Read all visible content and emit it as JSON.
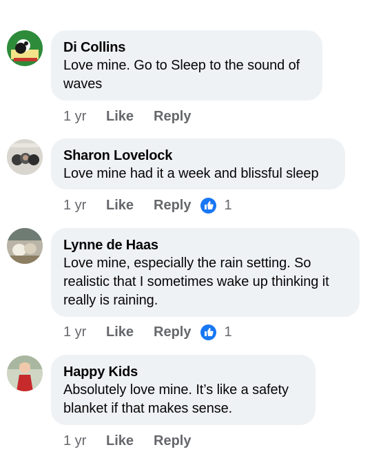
{
  "colors": {
    "bubble": "#eff2f5",
    "meta": "#65676b",
    "like_badge": "#1877f2"
  },
  "comments": [
    {
      "author": "Di Collins",
      "text": "Love mine. Go to Sleep to the sound of waves",
      "time": "1 yr",
      "like_label": "Like",
      "reply_label": "Reply",
      "avatar_icon": "dog-avatar-icon"
    },
    {
      "author": "Sharon Lovelock",
      "text": "Love mine had it a week and blissful sleep",
      "time": "1 yr",
      "like_label": "Like",
      "reply_label": "Reply",
      "reactions": "1",
      "avatar_icon": "family-photo-avatar-icon"
    },
    {
      "author": "Lynne de Haas",
      "text": "Love mine, especially the rain setting. So realistic that I sometimes wake up thinking it really is raining.",
      "time": "1 yr",
      "like_label": "Like",
      "reply_label": "Reply",
      "reactions": "1",
      "avatar_icon": "dogs-avatar-icon"
    },
    {
      "author": "Happy Kids",
      "text": "Absolutely love mine. It’s like a safety blanket if that makes sense.",
      "time": "1 yr",
      "like_label": "Like",
      "reply_label": "Reply",
      "avatar_icon": "child-avatar-icon"
    }
  ]
}
